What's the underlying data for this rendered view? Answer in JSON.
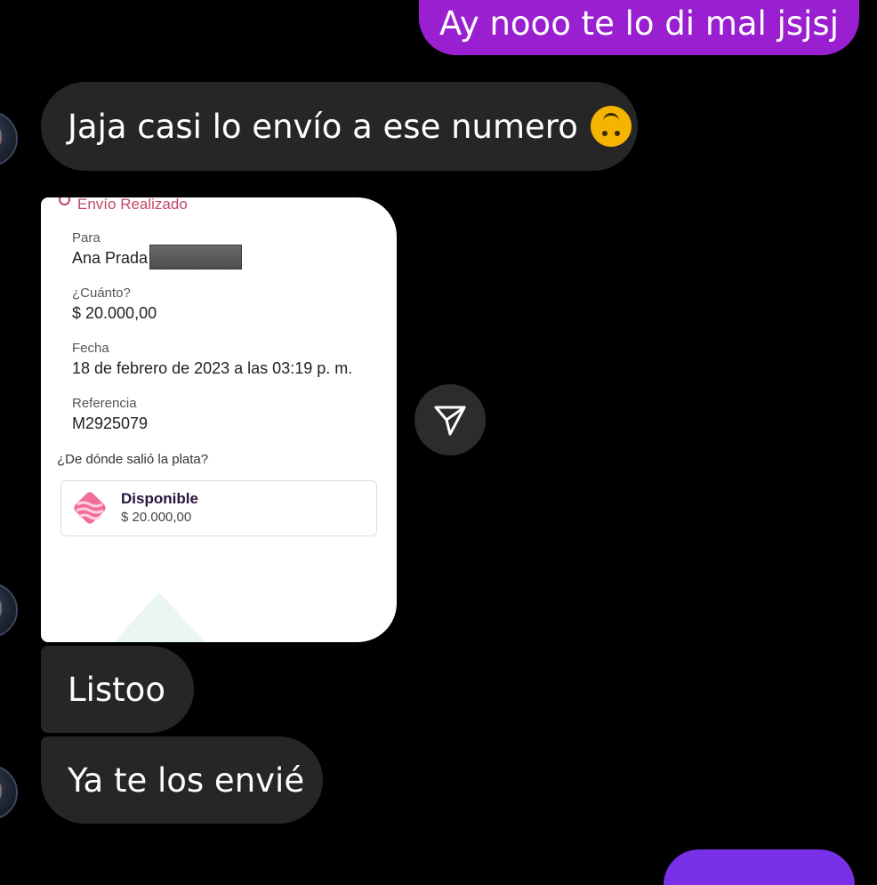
{
  "messages": {
    "outgoing_top": "Ay nooo te lo di mal jsjsj",
    "incoming_1": "Jaja casi lo envío a ese numero",
    "incoming_1_emoji": "🙃",
    "incoming_2": "Listoo",
    "incoming_3": "Ya te los envié"
  },
  "receipt": {
    "status": "Envío Realizado",
    "para_label": "Para",
    "para_value": "Ana Prada",
    "cuanto_label": "¿Cuánto?",
    "cuanto_value": "$ 20.000,00",
    "fecha_label": "Fecha",
    "fecha_value": "18 de febrero de 2023 a las 03:19 p. m.",
    "referencia_label": "Referencia",
    "referencia_value": "M2925079",
    "source_question": "¿De dónde salió la plata?",
    "source_name": "Disponible",
    "source_amount": "$ 20.000,00"
  },
  "icons": {
    "send": "send-icon",
    "avatar": "avatar",
    "status": "status-icon",
    "pocket": "pocket-icon"
  },
  "colors": {
    "outgoing_bubble": "#9a1fd0",
    "incoming_bubble": "#262626",
    "status_text": "#c24869",
    "background": "#000000"
  }
}
